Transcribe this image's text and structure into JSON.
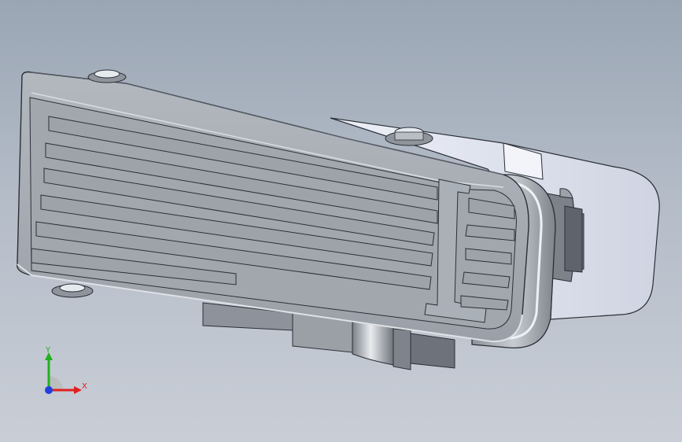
{
  "viewport": {
    "background_top": "#9aa6b4",
    "background_bottom": "#c9ced6"
  },
  "model": {
    "body_color": "#a6abb3",
    "shade_color": "#8c929b",
    "highlight_color": "#d8dce2",
    "bracket_color": "#dfe3ee",
    "edge_color": "#2b2f36"
  },
  "triad": {
    "x_label": "X",
    "y_label": "Y",
    "x_color": "#e02020",
    "y_color": "#20b020",
    "z_color": "#2040e0"
  }
}
